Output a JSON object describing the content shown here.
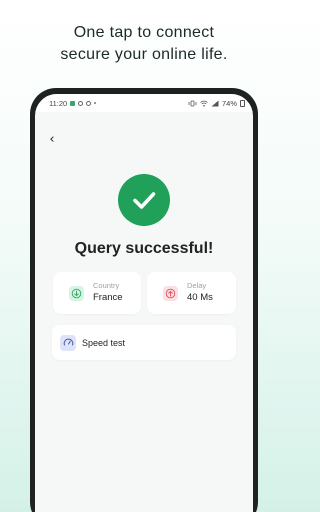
{
  "promo": {
    "line1": "One tap to connect",
    "line2": "secure your online life."
  },
  "status_bar": {
    "time": "11:20",
    "battery": "74%"
  },
  "nav": {
    "back_icon": "chevron-left-icon",
    "back_glyph": "‹"
  },
  "result": {
    "icon": "checkmark-icon",
    "title": "Query successful!"
  },
  "info_cards": {
    "country": {
      "label": "Country",
      "value": "France",
      "icon": "arrow-down-icon"
    },
    "delay": {
      "label": "Delay",
      "value": "40 Ms",
      "icon": "arrow-up-icon"
    }
  },
  "speed_test": {
    "label": "Speed test",
    "icon": "speedometer-icon"
  },
  "colors": {
    "accent": "#21a05a",
    "country_icon_bg": "#d7f3e3",
    "delay_icon_bg": "#fbe0e2",
    "speed_icon_bg": "#dfe3f7"
  }
}
